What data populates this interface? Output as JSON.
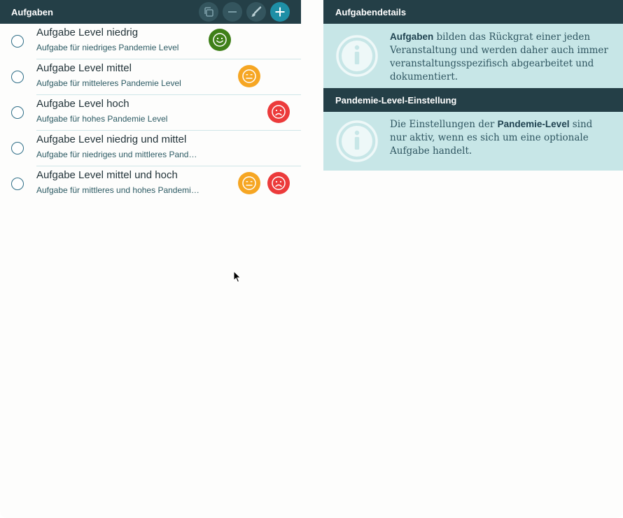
{
  "left_panel": {
    "title": "Aufgaben",
    "toolbar": {
      "copy_icon": "copy-icon",
      "remove_icon": "minus-icon",
      "edit_icon": "brush-icon",
      "add_icon": "plus-icon"
    },
    "tasks": [
      {
        "name": "Aufgabe Level niedrig",
        "subtitle": "Aufgabe für niedriges Pandemie Level",
        "levels": [
          "low"
        ]
      },
      {
        "name": "Aufgabe Level mittel",
        "subtitle": "Aufgabe für mitteleres Pandemie Level",
        "levels": [
          "medium"
        ]
      },
      {
        "name": "Aufgabe Level hoch",
        "subtitle": "Aufgabe für hohes Pandemie Level",
        "levels": [
          "high"
        ]
      },
      {
        "name": "Aufgabe Level niedrig und mittel",
        "subtitle": "Aufgabe für niedriges und mittleres Pandemie Level",
        "levels": []
      },
      {
        "name": "Aufgabe Level mittel und hoch",
        "subtitle": "Aufgabe für mittleres und hohes Pandemie Level",
        "levels": [
          "medium",
          "high"
        ]
      }
    ]
  },
  "right_panel": {
    "details_title": "Aufgabendetails",
    "details_info": {
      "bold": "Aufgaben",
      "text": " bilden das Rückgrat einer jeden Veranstaltung und werden daher auch immer veranstaltungsspezifisch abgearbeitet und dokumentiert."
    },
    "pandemic_title": "Pandemie-Level-Einstellung",
    "pandemic_info": {
      "prefix": "Die Einstellungen der ",
      "bold": "Pandemie-Level",
      "suffix": " sind nur aktiv, wenn es sich um eine optionale Aufgabe handelt."
    }
  },
  "colors": {
    "header_bg": "#243f47",
    "info_bg": "#c7e6e7",
    "accent": "#1e8fa6",
    "level_low": "#3f8019",
    "level_medium": "#f6a623",
    "level_high": "#ec3b3b"
  }
}
